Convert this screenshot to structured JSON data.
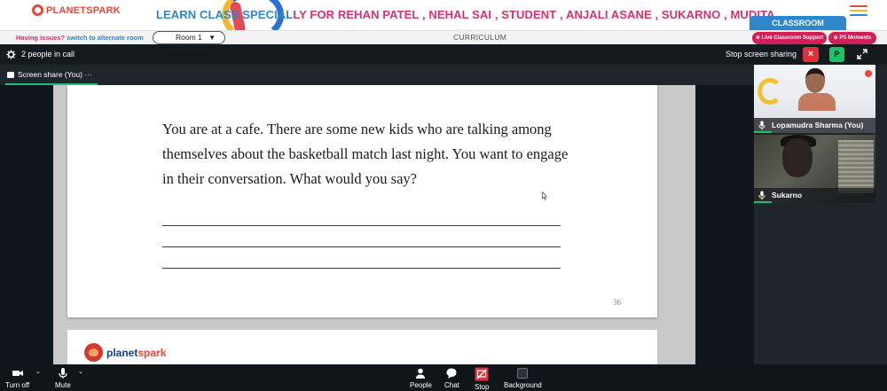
{
  "header": {
    "logo_text": "PLANETSPARK",
    "title_part1": "LEARN CLASS SPECIAL",
    "title_part2": "LY FOR REHAN PATEL , NEHAL SAI , STUDENT , ANJALI ASANE , SUKARNO , MUDITA",
    "classroom_label": "CLASSROOM",
    "menu_colors": [
      "#e7473c",
      "#f2b632",
      "#2f86c8"
    ]
  },
  "subbar": {
    "issues_text": "Having issues?",
    "alt_room_link": "switch to alternate room",
    "room_value": "Room 1",
    "curriculum_label": "CURRICULUM",
    "support_label": "⊕ Live Classroom Support",
    "moments_label": "⊕ PS Moments"
  },
  "meeting": {
    "people_count": "2 people in call",
    "stop_sharing_label": "Stop screen sharing",
    "stop_icon": "×",
    "participant_badge": "P",
    "share_tab_label": "Screen share (You)",
    "share_tab_more": "···"
  },
  "document": {
    "question": "You are at a cafe. There are some new kids who are talking among themselves about the basketball match last night. You want to engage in their conversation. What would you say?",
    "page_number": "36",
    "next_page_logo_a": "planet",
    "next_page_logo_b": "spark"
  },
  "participants": [
    {
      "name": "Lopamudra Sharma (You)"
    },
    {
      "name": "Sukarno"
    }
  ],
  "toolbar": {
    "turn_off": "Turn off",
    "mute": "Mute",
    "people": "People",
    "chat": "Chat",
    "stop": "Stop",
    "background": "Background"
  },
  "colors": {
    "brand_red": "#e7473c",
    "brand_blue": "#2f86c8",
    "pink": "#d5326e",
    "green": "#1fc26b",
    "stop_red": "#e0313b"
  }
}
